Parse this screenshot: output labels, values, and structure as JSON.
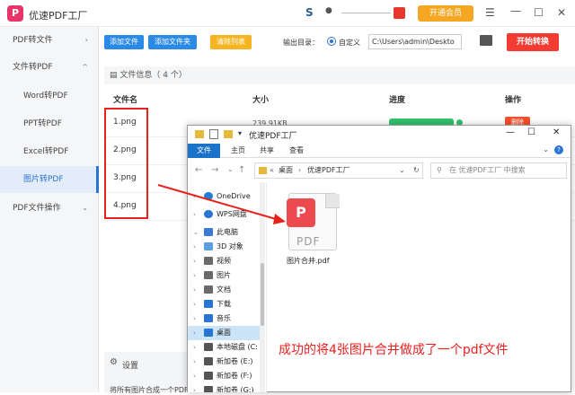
{
  "app": {
    "title": "优速PDF工厂",
    "vip_label": "开通会员"
  },
  "sidebar": {
    "items": [
      {
        "label": "PDF转文件",
        "chevron": "›"
      },
      {
        "label": "文件转PDF",
        "chevron": "^"
      },
      {
        "label": "Word转PDF"
      },
      {
        "label": "PPT转PDF"
      },
      {
        "label": "Excel转PDF"
      },
      {
        "label": "图片转PDF"
      },
      {
        "label": "PDF文件操作",
        "chevron": "⌄"
      }
    ]
  },
  "toolbar": {
    "add_file": "添加文件",
    "add_folder": "添加文件夹",
    "clear_list": "清除列表",
    "output_label": "输出目录：",
    "custom_label": "自定义",
    "output_path": "C:\\Users\\admin\\Deskto",
    "start": "开始转换"
  },
  "filelist": {
    "header": "文件信息（ 4 个）",
    "columns": {
      "name": "文件名",
      "size": "大小",
      "progress": "进度",
      "action": "操作"
    },
    "rows": [
      {
        "name": "1.png",
        "size": "239.91KB",
        "delete": "删除"
      },
      {
        "name": "2.png"
      },
      {
        "name": "3.png"
      },
      {
        "name": "4.png"
      }
    ]
  },
  "settings": {
    "label": "设置",
    "desc": "将所有图片合成一个PDF"
  },
  "explorer": {
    "title": "优速PDF工厂",
    "ribbon": [
      "文件",
      "主页",
      "共享",
      "查看"
    ],
    "address": {
      "root": "桌面",
      "folder": "优速PDF工厂",
      "sep1": "«",
      "sep2": "›"
    },
    "search_placeholder": "在 优速PDF工厂 中搜索",
    "nav": [
      {
        "label": "OneDrive",
        "color": "#1e7fd6"
      },
      {
        "label": "WPS网盘",
        "color": "#2a74d4"
      },
      {
        "label": "此电脑",
        "color": "#3a7bd5"
      },
      {
        "label": "3D 对象",
        "color": "#5aa0e0"
      },
      {
        "label": "视频",
        "color": "#6a6a6a"
      },
      {
        "label": "图片",
        "color": "#6a6a6a"
      },
      {
        "label": "文档",
        "color": "#6a6a6a"
      },
      {
        "label": "下载",
        "color": "#2a74d4"
      },
      {
        "label": "音乐",
        "color": "#2a74d4"
      },
      {
        "label": "桌面",
        "color": "#2a74d4"
      },
      {
        "label": "本地磁盘 (C:",
        "color": "#555555"
      },
      {
        "label": "新加卷 (E:)",
        "color": "#555555"
      },
      {
        "label": "新加卷 (F:)",
        "color": "#555555"
      },
      {
        "label": "新加卷 (G:)",
        "color": "#555555"
      }
    ],
    "file": {
      "name": "图片合并.pdf",
      "icon_text": "PDF",
      "badge": "P"
    }
  },
  "caption": "成功的将4张图片合并做成了一个pdf文件",
  "colors": {
    "accent": "#2a74d4",
    "start": "#f23c33",
    "highlight": "#e8221b",
    "vip": "#f5a623"
  }
}
